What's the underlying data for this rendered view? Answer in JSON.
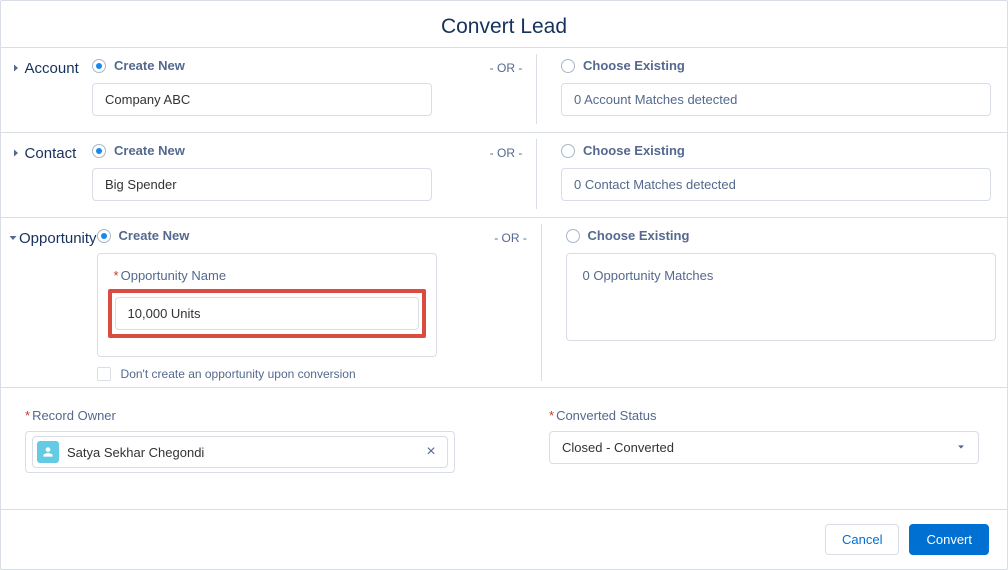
{
  "header": {
    "title": "Convert Lead"
  },
  "or_label": "- OR -",
  "sections": {
    "account": {
      "label": "Account",
      "create": {
        "radio_label": "Create New",
        "value": "Company ABC"
      },
      "existing": {
        "radio_label": "Choose Existing",
        "matches_text": "0 Account Matches detected"
      }
    },
    "contact": {
      "label": "Contact",
      "create": {
        "radio_label": "Create New",
        "value": "Big Spender"
      },
      "existing": {
        "radio_label": "Choose Existing",
        "matches_text": "0 Contact Matches detected"
      }
    },
    "opportunity": {
      "label": "Opportunity",
      "create": {
        "radio_label": "Create New",
        "name_label": "Opportunity Name",
        "name_value": "10,000 Units",
        "skip_checkbox_label": "Don't create an opportunity upon conversion"
      },
      "existing": {
        "radio_label": "Choose Existing",
        "matches_text": "0 Opportunity Matches"
      }
    }
  },
  "bottom": {
    "record_owner": {
      "label": "Record Owner",
      "value": "Satya Sekhar Chegondi"
    },
    "converted_status": {
      "label": "Converted Status",
      "value": "Closed - Converted"
    }
  },
  "footer": {
    "cancel": "Cancel",
    "convert": "Convert"
  }
}
